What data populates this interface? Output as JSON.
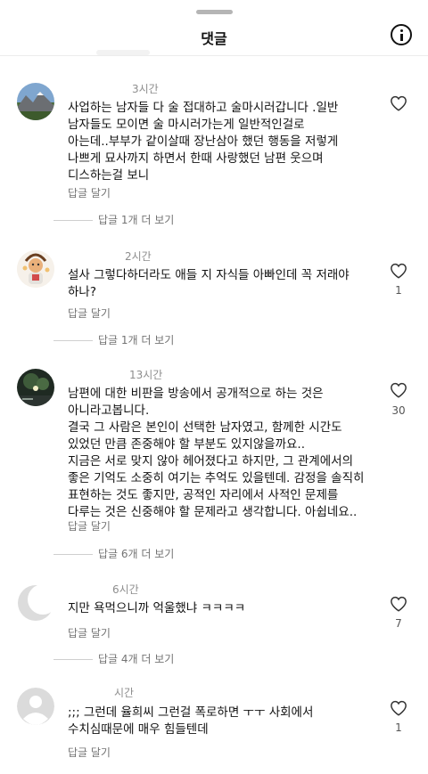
{
  "header": {
    "title": "댓글"
  },
  "comments": [
    {
      "username": "",
      "time": "3시간",
      "lines": [
        "사업하는 남자들 다  술 접대하고 술마시러갑니다 .일반",
        "남자들도  모이면 술 마시러가는게  일반적인걸로",
        "아는데..부부가 같이살때  장난삼아  했던 행동을 저렇게",
        "나쁘게 묘사까지 하면서  한때 사랑했던 남편 웃으며",
        "디스하는걸 보니"
      ],
      "reply_label": "답글 달기",
      "likes": "",
      "more_replies": "답글 1개 더 보기",
      "avatar": "mountain-landscape"
    },
    {
      "username": "",
      "time": "2시간",
      "lines": [
        "설사 그렇다하더라도  애들 지 자식들 아빠인데 꼭 저래야",
        "하나?"
      ],
      "reply_label": "답글 달기",
      "likes": "1",
      "more_replies": "답글 1개 더 보기",
      "avatar": "cartoon-character"
    },
    {
      "username": "",
      "time": "13시간",
      "lines": [
        "남편에 대한 비판을 방송에서 공개적으로 하는 것은",
        "아니라고봅니다.",
        "결국 그 사람은 본인이 선택한 남자였고, 함께한 시간도",
        "있었던 만큼 존중해야 할 부분도 있지않을까요..",
        "지금은 서로 맞지 않아 헤어졌다고 하지만, 그 관계에서의",
        "좋은 기억도 소중히 여기는 추억도 있을텐데. 감정을 솔직히",
        "표현하는 것도 좋지만, 공적인 자리에서 사적인 문제를",
        "다루는 것은 신중해야 할 문제라고 생각합니다. 아쉽네요.."
      ],
      "reply_label": "답글 달기",
      "likes": "30",
      "more_replies": "답글 6개 더 보기",
      "avatar": "night-street"
    },
    {
      "username": "",
      "time": "6시간",
      "lines": [
        "지만 욕먹으니까 억울했냐 ㅋㅋㅋㅋ"
      ],
      "reply_label": "답글 달기",
      "likes": "7",
      "more_replies": "답글 4개 더 보기",
      "avatar": "grey-crescent"
    },
    {
      "username": "",
      "time": "시간",
      "lines": [
        ";;; 그런데 율희씨 그런걸  폭로하면 ㅜㅜ 사회에서",
        "수치심때문에 매우 힘들텐데"
      ],
      "reply_label": "답글 달기",
      "likes": "1",
      "more_replies": "",
      "avatar": "default-person"
    }
  ],
  "icons": {
    "heart": "heart-outline-icon",
    "info": "info-icon"
  }
}
